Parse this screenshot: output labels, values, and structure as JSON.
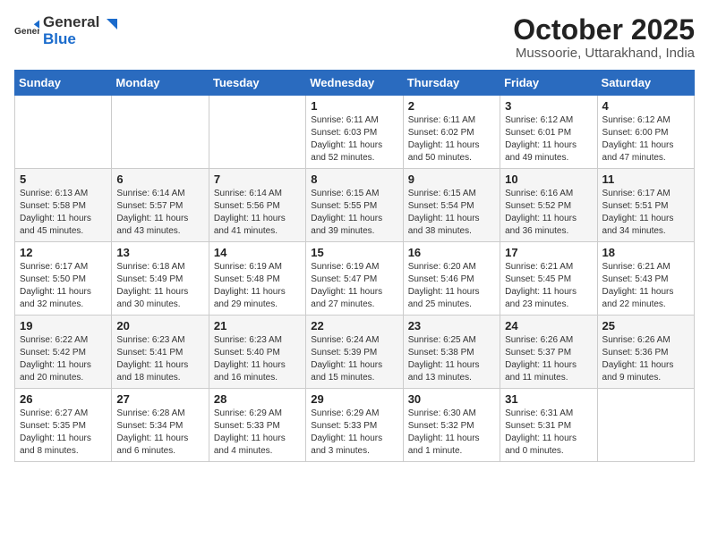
{
  "header": {
    "logo_general": "General",
    "logo_blue": "Blue",
    "month": "October 2025",
    "location": "Mussoorie, Uttarakhand, India"
  },
  "weekdays": [
    "Sunday",
    "Monday",
    "Tuesday",
    "Wednesday",
    "Thursday",
    "Friday",
    "Saturday"
  ],
  "weeks": [
    [
      {
        "day": "",
        "info": ""
      },
      {
        "day": "",
        "info": ""
      },
      {
        "day": "",
        "info": ""
      },
      {
        "day": "1",
        "info": "Sunrise: 6:11 AM\nSunset: 6:03 PM\nDaylight: 11 hours\nand 52 minutes."
      },
      {
        "day": "2",
        "info": "Sunrise: 6:11 AM\nSunset: 6:02 PM\nDaylight: 11 hours\nand 50 minutes."
      },
      {
        "day": "3",
        "info": "Sunrise: 6:12 AM\nSunset: 6:01 PM\nDaylight: 11 hours\nand 49 minutes."
      },
      {
        "day": "4",
        "info": "Sunrise: 6:12 AM\nSunset: 6:00 PM\nDaylight: 11 hours\nand 47 minutes."
      }
    ],
    [
      {
        "day": "5",
        "info": "Sunrise: 6:13 AM\nSunset: 5:58 PM\nDaylight: 11 hours\nand 45 minutes."
      },
      {
        "day": "6",
        "info": "Sunrise: 6:14 AM\nSunset: 5:57 PM\nDaylight: 11 hours\nand 43 minutes."
      },
      {
        "day": "7",
        "info": "Sunrise: 6:14 AM\nSunset: 5:56 PM\nDaylight: 11 hours\nand 41 minutes."
      },
      {
        "day": "8",
        "info": "Sunrise: 6:15 AM\nSunset: 5:55 PM\nDaylight: 11 hours\nand 39 minutes."
      },
      {
        "day": "9",
        "info": "Sunrise: 6:15 AM\nSunset: 5:54 PM\nDaylight: 11 hours\nand 38 minutes."
      },
      {
        "day": "10",
        "info": "Sunrise: 6:16 AM\nSunset: 5:52 PM\nDaylight: 11 hours\nand 36 minutes."
      },
      {
        "day": "11",
        "info": "Sunrise: 6:17 AM\nSunset: 5:51 PM\nDaylight: 11 hours\nand 34 minutes."
      }
    ],
    [
      {
        "day": "12",
        "info": "Sunrise: 6:17 AM\nSunset: 5:50 PM\nDaylight: 11 hours\nand 32 minutes."
      },
      {
        "day": "13",
        "info": "Sunrise: 6:18 AM\nSunset: 5:49 PM\nDaylight: 11 hours\nand 30 minutes."
      },
      {
        "day": "14",
        "info": "Sunrise: 6:19 AM\nSunset: 5:48 PM\nDaylight: 11 hours\nand 29 minutes."
      },
      {
        "day": "15",
        "info": "Sunrise: 6:19 AM\nSunset: 5:47 PM\nDaylight: 11 hours\nand 27 minutes."
      },
      {
        "day": "16",
        "info": "Sunrise: 6:20 AM\nSunset: 5:46 PM\nDaylight: 11 hours\nand 25 minutes."
      },
      {
        "day": "17",
        "info": "Sunrise: 6:21 AM\nSunset: 5:45 PM\nDaylight: 11 hours\nand 23 minutes."
      },
      {
        "day": "18",
        "info": "Sunrise: 6:21 AM\nSunset: 5:43 PM\nDaylight: 11 hours\nand 22 minutes."
      }
    ],
    [
      {
        "day": "19",
        "info": "Sunrise: 6:22 AM\nSunset: 5:42 PM\nDaylight: 11 hours\nand 20 minutes."
      },
      {
        "day": "20",
        "info": "Sunrise: 6:23 AM\nSunset: 5:41 PM\nDaylight: 11 hours\nand 18 minutes."
      },
      {
        "day": "21",
        "info": "Sunrise: 6:23 AM\nSunset: 5:40 PM\nDaylight: 11 hours\nand 16 minutes."
      },
      {
        "day": "22",
        "info": "Sunrise: 6:24 AM\nSunset: 5:39 PM\nDaylight: 11 hours\nand 15 minutes."
      },
      {
        "day": "23",
        "info": "Sunrise: 6:25 AM\nSunset: 5:38 PM\nDaylight: 11 hours\nand 13 minutes."
      },
      {
        "day": "24",
        "info": "Sunrise: 6:26 AM\nSunset: 5:37 PM\nDaylight: 11 hours\nand 11 minutes."
      },
      {
        "day": "25",
        "info": "Sunrise: 6:26 AM\nSunset: 5:36 PM\nDaylight: 11 hours\nand 9 minutes."
      }
    ],
    [
      {
        "day": "26",
        "info": "Sunrise: 6:27 AM\nSunset: 5:35 PM\nDaylight: 11 hours\nand 8 minutes."
      },
      {
        "day": "27",
        "info": "Sunrise: 6:28 AM\nSunset: 5:34 PM\nDaylight: 11 hours\nand 6 minutes."
      },
      {
        "day": "28",
        "info": "Sunrise: 6:29 AM\nSunset: 5:33 PM\nDaylight: 11 hours\nand 4 minutes."
      },
      {
        "day": "29",
        "info": "Sunrise: 6:29 AM\nSunset: 5:33 PM\nDaylight: 11 hours\nand 3 minutes."
      },
      {
        "day": "30",
        "info": "Sunrise: 6:30 AM\nSunset: 5:32 PM\nDaylight: 11 hours\nand 1 minute."
      },
      {
        "day": "31",
        "info": "Sunrise: 6:31 AM\nSunset: 5:31 PM\nDaylight: 11 hours\nand 0 minutes."
      },
      {
        "day": "",
        "info": ""
      }
    ]
  ]
}
